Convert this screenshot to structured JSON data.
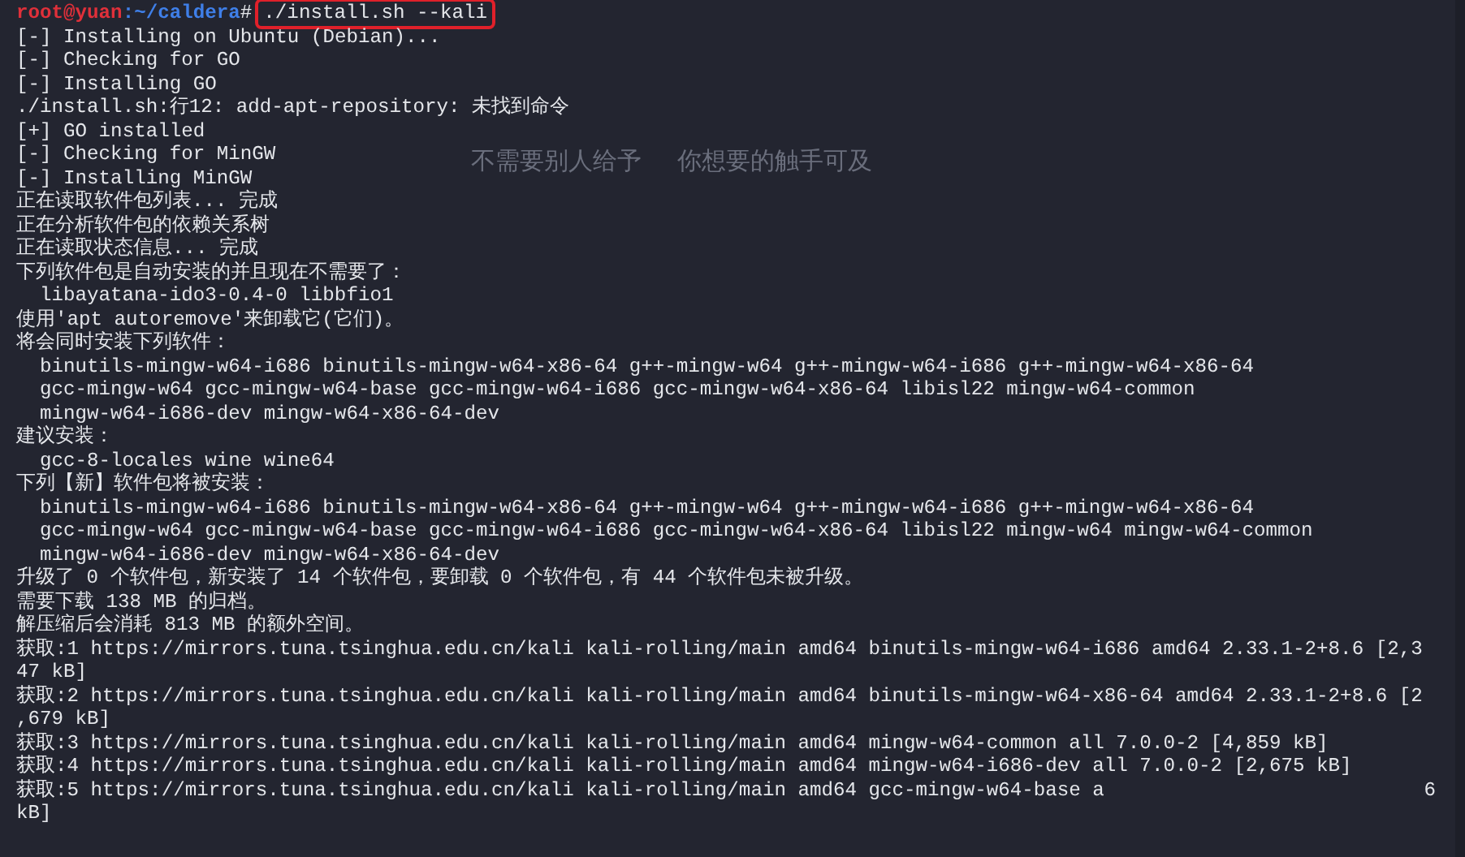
{
  "terminal": {
    "prompt": {
      "user_host": "root@yuan",
      "path": ":~/caldera",
      "symbol": "#",
      "command": "./install.sh --kali",
      "highlighted": true
    },
    "wallpaper_texts": [
      "不需要别人给予",
      "你想要的触手可及"
    ],
    "lines": [
      {
        "kind": "plain",
        "text": "[-] Installing on Ubuntu (Debian)..."
      },
      {
        "kind": "plain",
        "text": "[-] Checking for GO"
      },
      {
        "kind": "plain",
        "text": "[-] Installing GO"
      },
      {
        "kind": "plain",
        "text": "./install.sh:行12: add-apt-repository: 未找到命令"
      },
      {
        "kind": "plain",
        "text": "[+] GO installed"
      },
      {
        "kind": "plain",
        "text": "[-] Checking for MinGW"
      },
      {
        "kind": "plain",
        "text": "[-] Installing MinGW"
      },
      {
        "kind": "plain",
        "text": "正在读取软件包列表... 完成"
      },
      {
        "kind": "plain",
        "text": "正在分析软件包的依赖关系树"
      },
      {
        "kind": "plain",
        "text": "正在读取状态信息... 完成"
      },
      {
        "kind": "plain",
        "text": "下列软件包是自动安装的并且现在不需要了："
      },
      {
        "kind": "indented",
        "text": "libayatana-ido3-0.4-0 libbfio1"
      },
      {
        "kind": "plain",
        "text": "使用'apt autoremove'来卸载它(它们)。"
      },
      {
        "kind": "plain",
        "text": "将会同时安装下列软件："
      },
      {
        "kind": "indented",
        "text": "binutils-mingw-w64-i686 binutils-mingw-w64-x86-64 g++-mingw-w64 g++-mingw-w64-i686 g++-mingw-w64-x86-64"
      },
      {
        "kind": "indented",
        "text": "gcc-mingw-w64 gcc-mingw-w64-base gcc-mingw-w64-i686 gcc-mingw-w64-x86-64 libisl22 mingw-w64-common"
      },
      {
        "kind": "indented",
        "text": "mingw-w64-i686-dev mingw-w64-x86-64-dev"
      },
      {
        "kind": "plain",
        "text": "建议安装："
      },
      {
        "kind": "indented",
        "text": "gcc-8-locales wine wine64"
      },
      {
        "kind": "plain",
        "text": "下列【新】软件包将被安装："
      },
      {
        "kind": "indented",
        "text": "binutils-mingw-w64-i686 binutils-mingw-w64-x86-64 g++-mingw-w64 g++-mingw-w64-i686 g++-mingw-w64-x86-64"
      },
      {
        "kind": "indented",
        "text": "gcc-mingw-w64 gcc-mingw-w64-base gcc-mingw-w64-i686 gcc-mingw-w64-x86-64 libisl22 mingw-w64 mingw-w64-common"
      },
      {
        "kind": "indented",
        "text": "mingw-w64-i686-dev mingw-w64-x86-64-dev"
      },
      {
        "kind": "plain",
        "text": "升级了 0 个软件包，新安装了 14 个软件包，要卸载 0 个软件包，有 44 个软件包未被升级。"
      },
      {
        "kind": "plain",
        "text": "需要下载 138 MB 的归档。"
      },
      {
        "kind": "plain",
        "text": "解压缩后会消耗 813 MB 的额外空间。"
      },
      {
        "kind": "plain",
        "text": "获取:1 https://mirrors.tuna.tsinghua.edu.cn/kali kali-rolling/main amd64 binutils-mingw-w64-i686 amd64 2.33.1-2+8.6 [2,3"
      },
      {
        "kind": "plain",
        "text": "47 kB]"
      },
      {
        "kind": "plain",
        "text": "获取:2 https://mirrors.tuna.tsinghua.edu.cn/kali kali-rolling/main amd64 binutils-mingw-w64-x86-64 amd64 2.33.1-2+8.6 [2"
      },
      {
        "kind": "plain",
        "text": ",679 kB]"
      },
      {
        "kind": "plain",
        "text": "获取:3 https://mirrors.tuna.tsinghua.edu.cn/kali kali-rolling/main amd64 mingw-w64-common all 7.0.0-2 [4,859 kB]"
      },
      {
        "kind": "plain",
        "text": "获取:4 https://mirrors.tuna.tsinghua.edu.cn/kali kali-rolling/main amd64 mingw-w64-i686-dev all 7.0.0-2 [2,675 kB]"
      },
      {
        "kind": "split",
        "parts": [
          "获取:5 https://mirrors.tuna.tsinghua.edu.cn/kali kali-rolling/main amd64 gcc-mingw-w64-base a",
          "6"
        ]
      },
      {
        "kind": "plain",
        "text": "kB]"
      }
    ]
  }
}
